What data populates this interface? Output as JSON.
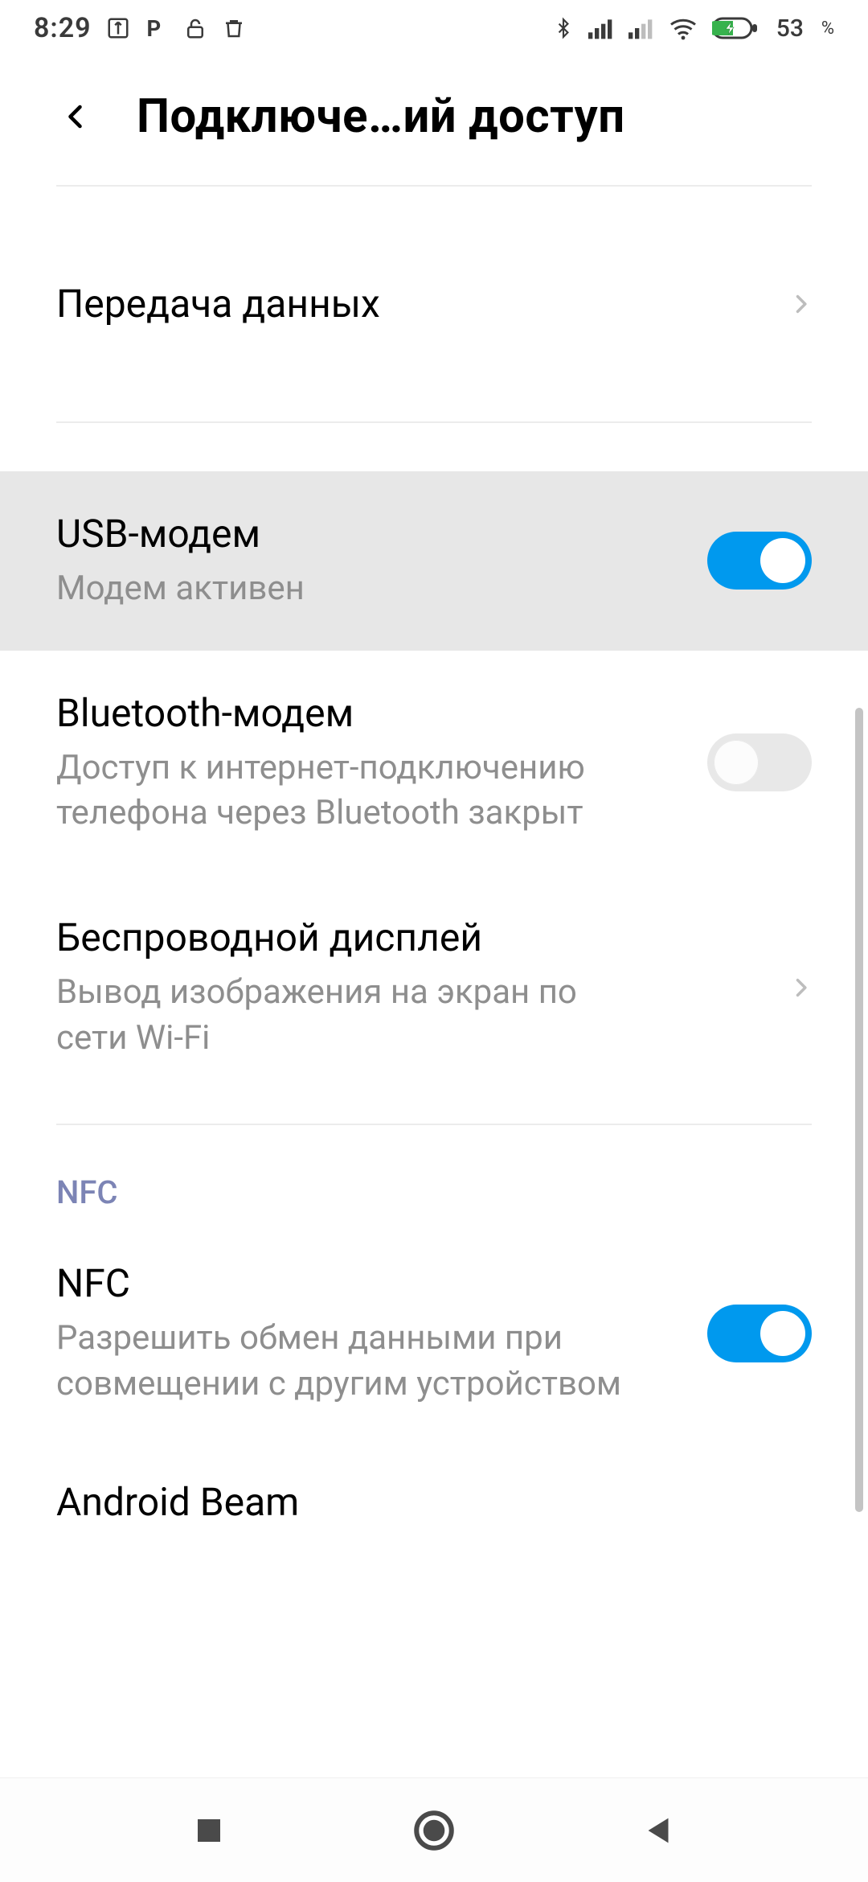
{
  "status": {
    "time": "8:29",
    "battery_level": "53",
    "battery_unit": "%"
  },
  "header": {
    "title": "Подключе…ий доступ"
  },
  "rows": {
    "data_usage": {
      "title": "Передача данных"
    },
    "usb_tether": {
      "title": "USB-модем",
      "subtitle": "Модем активен",
      "on": true
    },
    "bt_tether": {
      "title": "Bluetooth-модем",
      "subtitle": "Доступ к интернет-подключению телефона через Bluetooth закрыт",
      "on": false
    },
    "wireless_display": {
      "title": "Беспроводной дисплей",
      "subtitle": "Вывод изображения на экран по сети Wi-Fi"
    },
    "nfc": {
      "title": "NFC",
      "subtitle": "Разрешить обмен данными при совмещении с другим устройством",
      "on": true
    },
    "android_beam": {
      "title": "Android Beam"
    }
  },
  "sections": {
    "nfc": "NFC"
  },
  "colors": {
    "accent": "#0099ee",
    "muted": "#8e8e8e",
    "section": "#7c84b5",
    "highlight": "#e7e7e7"
  }
}
